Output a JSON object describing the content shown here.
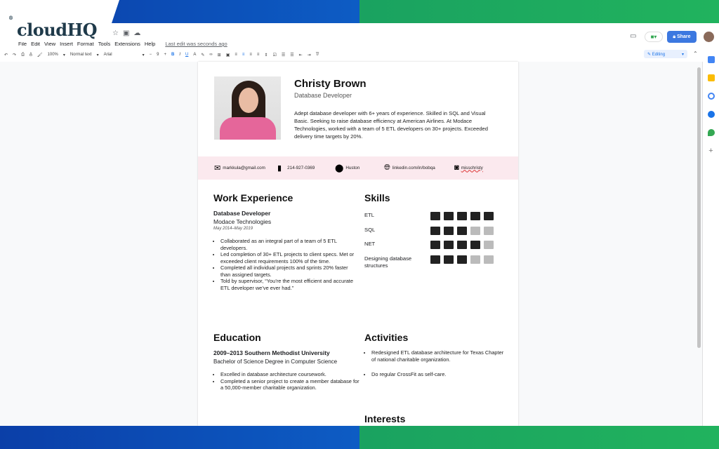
{
  "brand": {
    "logo": "cloudHQ",
    "reg": "®"
  },
  "menu": [
    "File",
    "Edit",
    "View",
    "Insert",
    "Format",
    "Tools",
    "Extensions",
    "Help"
  ],
  "last_edit": "Last edit was seconds ago",
  "toolbar": {
    "zoom": "100%",
    "style": "Normal text",
    "font": "Arial",
    "size": "9",
    "mode": "Editing"
  },
  "share_label": "Share",
  "resume": {
    "name": "Christy Brown",
    "role": "Database Developer",
    "summary": "Adept database developer with 6+ years of experience. Skilled in SQL and Visual Basic. Seeking to raise database efficiency at American Airlines. At Modace Technologies, worked with a team of 5 ETL developers on 30+ projects. Exceeded delivery time targets by 20%.",
    "contact": {
      "email": "markkula@gmail.com",
      "phone": "214-927-0369",
      "location": "Huston",
      "linkedin": "linkedin.com/in/bobqa",
      "instagram": "misschristy"
    },
    "work": {
      "heading": "Work Experience",
      "title": "Database Developer",
      "company": "Modace Technologies",
      "dates": "May 2014–May 2019",
      "bullets": [
        "Collaborated as an integral part of a team of 5 ETL developers.",
        "Led completion of 30+ ETL projects to client specs. Met or exceeded client requirements 100% of the time.",
        "Completed all individual projects and sprints 20% faster than assigned targets.",
        "Told by supervisor, “You’re the most efficient and accurate ETL developer we’ve ever had.”"
      ]
    },
    "skills": {
      "heading": "Skills",
      "max": 5,
      "items": [
        {
          "name": "ETL",
          "level": 5
        },
        {
          "name": "SQL",
          "level": 3
        },
        {
          "name": "NET",
          "level": 4
        },
        {
          "name": "Designing database structures",
          "level": 3
        }
      ]
    },
    "education": {
      "heading": "Education",
      "title": "2009–2013 Southern Methodist University",
      "degree": "Bachelor of Science Degree in Computer Science",
      "bullets": [
        "Excelled in database architecture coursework.",
        "Completed a senior project to create a member database for a 50,000-member charitable organization."
      ]
    },
    "activities": {
      "heading": "Activities",
      "bullets": [
        "Redesigned ETL database architecture for Texas Chapter of national charitable organization.",
        "Do regular CrossFit as self-care."
      ]
    },
    "interests": {
      "heading": "Interests"
    }
  }
}
